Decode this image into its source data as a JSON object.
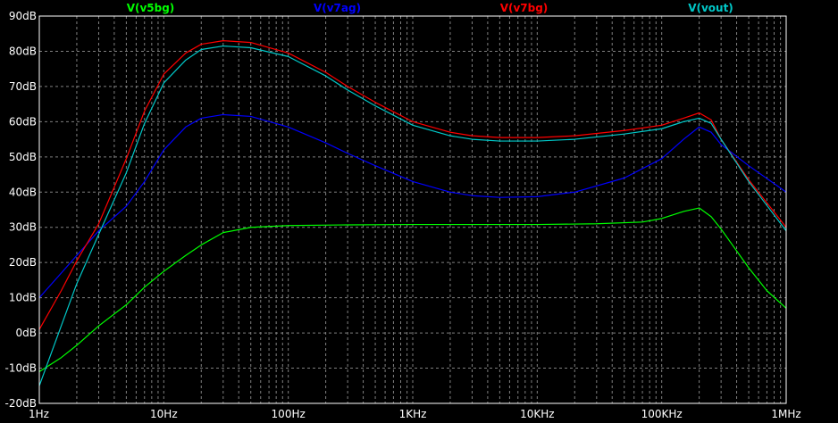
{
  "chart_data": {
    "type": "line",
    "x_scale": "log",
    "xlim": [
      1,
      1000000
    ],
    "ylim": [
      -20,
      90
    ],
    "grid": true,
    "legend_position": "top",
    "background": "#000000",
    "grid_color": "#808080",
    "x_ticks": [
      {
        "value": 1,
        "label": "1Hz"
      },
      {
        "value": 10,
        "label": "10Hz"
      },
      {
        "value": 100,
        "label": "100Hz"
      },
      {
        "value": 1000,
        "label": "1KHz"
      },
      {
        "value": 10000,
        "label": "10KHz"
      },
      {
        "value": 100000,
        "label": "100KHz"
      },
      {
        "value": 1000000,
        "label": "1MHz"
      }
    ],
    "y_ticks": [
      {
        "value": 90,
        "label": "90dB"
      },
      {
        "value": 80,
        "label": "80dB"
      },
      {
        "value": 70,
        "label": "70dB"
      },
      {
        "value": 60,
        "label": "60dB"
      },
      {
        "value": 50,
        "label": "50dB"
      },
      {
        "value": 40,
        "label": "40dB"
      },
      {
        "value": 30,
        "label": "30dB"
      },
      {
        "value": 20,
        "label": "20dB"
      },
      {
        "value": 10,
        "label": "10dB"
      },
      {
        "value": 0,
        "label": "0dB"
      },
      {
        "value": -10,
        "label": "-10dB"
      },
      {
        "value": -20,
        "label": "-20dB"
      }
    ],
    "series": [
      {
        "name": "V(v5bg)",
        "color": "#00ff00",
        "x": [
          1,
          1.5,
          2,
          3,
          5,
          7,
          10,
          15,
          20,
          30,
          50,
          100,
          300,
          1000,
          3000,
          10000,
          30000,
          70000,
          100000,
          150000,
          200000,
          250000,
          300000,
          500000,
          700000,
          1000000
        ],
        "y": [
          -11,
          -7,
          -3.5,
          2,
          8,
          13,
          17.5,
          22,
          25,
          28.5,
          30,
          30.5,
          30.7,
          30.8,
          30.8,
          30.8,
          31,
          31.5,
          32.5,
          34.5,
          35.5,
          33,
          29.5,
          18.5,
          12,
          7
        ]
      },
      {
        "name": "V(v7ag)",
        "color": "#0000ff",
        "x": [
          1,
          1.5,
          2,
          3,
          5,
          7,
          10,
          15,
          20,
          30,
          50,
          100,
          200,
          300,
          500,
          1000,
          2000,
          3000,
          5000,
          10000,
          20000,
          50000,
          100000,
          150000,
          200000,
          250000,
          300000,
          500000,
          1000000
        ],
        "y": [
          10,
          17,
          22,
          29,
          36,
          43,
          52,
          58.5,
          61,
          62,
          61.5,
          58.5,
          54,
          51,
          47.5,
          43,
          40,
          39,
          38.5,
          38.7,
          40,
          44,
          49.5,
          55,
          58.5,
          57,
          53.5,
          47.5,
          40
        ]
      },
      {
        "name": "V(v7bg)",
        "color": "#ff0000",
        "x": [
          1,
          1.5,
          2,
          3,
          5,
          7,
          10,
          15,
          20,
          30,
          50,
          100,
          200,
          300,
          500,
          1000,
          2000,
          3000,
          5000,
          10000,
          20000,
          50000,
          100000,
          150000,
          200000,
          250000,
          300000,
          500000,
          1000000
        ],
        "y": [
          1,
          12,
          20.5,
          31,
          49.5,
          63,
          73.5,
          79.5,
          82,
          83,
          82.5,
          79.5,
          74,
          70,
          65.5,
          60,
          57,
          56,
          55.5,
          55.5,
          56,
          57.5,
          59,
          61,
          62.5,
          60.5,
          55,
          43.5,
          30
        ]
      },
      {
        "name": "V(vout)",
        "color": "#00c8c8",
        "x": [
          1,
          1.5,
          2,
          3,
          5,
          7,
          10,
          15,
          20,
          30,
          50,
          100,
          200,
          300,
          500,
          1000,
          2000,
          3000,
          5000,
          10000,
          20000,
          50000,
          100000,
          150000,
          200000,
          250000,
          300000,
          500000,
          1000000
        ],
        "y": [
          -15,
          2,
          14,
          28,
          45.5,
          59.5,
          71,
          77.5,
          80.5,
          81.5,
          81,
          78.5,
          73,
          69,
          64.5,
          59,
          56,
          55,
          54.5,
          54.5,
          55,
          56.5,
          58,
          60,
          61,
          59.5,
          55,
          43,
          29
        ]
      }
    ]
  }
}
